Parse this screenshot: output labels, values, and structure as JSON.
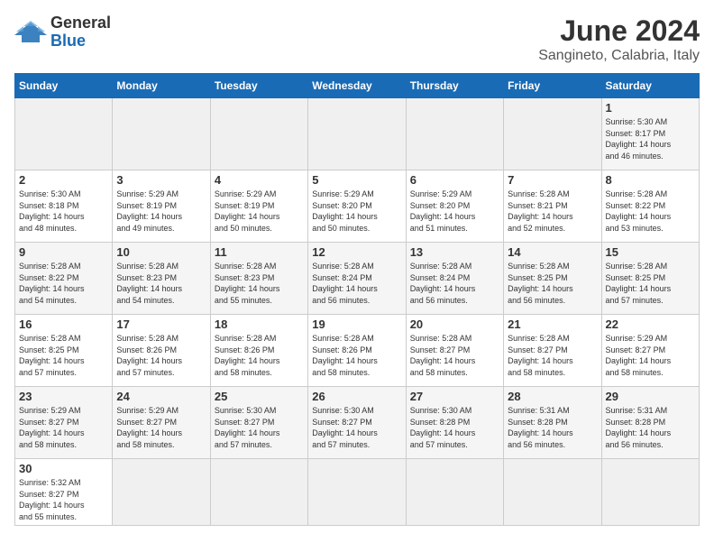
{
  "header": {
    "logo_general": "General",
    "logo_blue": "Blue",
    "title": "June 2024",
    "subtitle": "Sangineto, Calabria, Italy"
  },
  "weekdays": [
    "Sunday",
    "Monday",
    "Tuesday",
    "Wednesday",
    "Thursday",
    "Friday",
    "Saturday"
  ],
  "weeks": [
    [
      {
        "day": "",
        "info": ""
      },
      {
        "day": "",
        "info": ""
      },
      {
        "day": "",
        "info": ""
      },
      {
        "day": "",
        "info": ""
      },
      {
        "day": "",
        "info": ""
      },
      {
        "day": "",
        "info": ""
      },
      {
        "day": "1",
        "info": "Sunrise: 5:30 AM\nSunset: 8:17 PM\nDaylight: 14 hours\nand 46 minutes."
      }
    ],
    [
      {
        "day": "2",
        "info": "Sunrise: 5:30 AM\nSunset: 8:18 PM\nDaylight: 14 hours\nand 48 minutes."
      },
      {
        "day": "3",
        "info": "Sunrise: 5:29 AM\nSunset: 8:19 PM\nDaylight: 14 hours\nand 49 minutes."
      },
      {
        "day": "4",
        "info": "Sunrise: 5:29 AM\nSunset: 8:19 PM\nDaylight: 14 hours\nand 50 minutes."
      },
      {
        "day": "5",
        "info": "Sunrise: 5:29 AM\nSunset: 8:20 PM\nDaylight: 14 hours\nand 50 minutes."
      },
      {
        "day": "6",
        "info": "Sunrise: 5:29 AM\nSunset: 8:20 PM\nDaylight: 14 hours\nand 51 minutes."
      },
      {
        "day": "7",
        "info": "Sunrise: 5:28 AM\nSunset: 8:21 PM\nDaylight: 14 hours\nand 52 minutes."
      },
      {
        "day": "8",
        "info": "Sunrise: 5:28 AM\nSunset: 8:22 PM\nDaylight: 14 hours\nand 53 minutes."
      }
    ],
    [
      {
        "day": "9",
        "info": "Sunrise: 5:28 AM\nSunset: 8:22 PM\nDaylight: 14 hours\nand 54 minutes."
      },
      {
        "day": "10",
        "info": "Sunrise: 5:28 AM\nSunset: 8:23 PM\nDaylight: 14 hours\nand 54 minutes."
      },
      {
        "day": "11",
        "info": "Sunrise: 5:28 AM\nSunset: 8:23 PM\nDaylight: 14 hours\nand 55 minutes."
      },
      {
        "day": "12",
        "info": "Sunrise: 5:28 AM\nSunset: 8:24 PM\nDaylight: 14 hours\nand 56 minutes."
      },
      {
        "day": "13",
        "info": "Sunrise: 5:28 AM\nSunset: 8:24 PM\nDaylight: 14 hours\nand 56 minutes."
      },
      {
        "day": "14",
        "info": "Sunrise: 5:28 AM\nSunset: 8:25 PM\nDaylight: 14 hours\nand 56 minutes."
      },
      {
        "day": "15",
        "info": "Sunrise: 5:28 AM\nSunset: 8:25 PM\nDaylight: 14 hours\nand 57 minutes."
      }
    ],
    [
      {
        "day": "16",
        "info": "Sunrise: 5:28 AM\nSunset: 8:25 PM\nDaylight: 14 hours\nand 57 minutes."
      },
      {
        "day": "17",
        "info": "Sunrise: 5:28 AM\nSunset: 8:26 PM\nDaylight: 14 hours\nand 57 minutes."
      },
      {
        "day": "18",
        "info": "Sunrise: 5:28 AM\nSunset: 8:26 PM\nDaylight: 14 hours\nand 58 minutes."
      },
      {
        "day": "19",
        "info": "Sunrise: 5:28 AM\nSunset: 8:26 PM\nDaylight: 14 hours\nand 58 minutes."
      },
      {
        "day": "20",
        "info": "Sunrise: 5:28 AM\nSunset: 8:27 PM\nDaylight: 14 hours\nand 58 minutes."
      },
      {
        "day": "21",
        "info": "Sunrise: 5:28 AM\nSunset: 8:27 PM\nDaylight: 14 hours\nand 58 minutes."
      },
      {
        "day": "22",
        "info": "Sunrise: 5:29 AM\nSunset: 8:27 PM\nDaylight: 14 hours\nand 58 minutes."
      }
    ],
    [
      {
        "day": "23",
        "info": "Sunrise: 5:29 AM\nSunset: 8:27 PM\nDaylight: 14 hours\nand 58 minutes."
      },
      {
        "day": "24",
        "info": "Sunrise: 5:29 AM\nSunset: 8:27 PM\nDaylight: 14 hours\nand 58 minutes."
      },
      {
        "day": "25",
        "info": "Sunrise: 5:30 AM\nSunset: 8:27 PM\nDaylight: 14 hours\nand 57 minutes."
      },
      {
        "day": "26",
        "info": "Sunrise: 5:30 AM\nSunset: 8:27 PM\nDaylight: 14 hours\nand 57 minutes."
      },
      {
        "day": "27",
        "info": "Sunrise: 5:30 AM\nSunset: 8:28 PM\nDaylight: 14 hours\nand 57 minutes."
      },
      {
        "day": "28",
        "info": "Sunrise: 5:31 AM\nSunset: 8:28 PM\nDaylight: 14 hours\nand 56 minutes."
      },
      {
        "day": "29",
        "info": "Sunrise: 5:31 AM\nSunset: 8:28 PM\nDaylight: 14 hours\nand 56 minutes."
      }
    ],
    [
      {
        "day": "30",
        "info": "Sunrise: 5:32 AM\nSunset: 8:27 PM\nDaylight: 14 hours\nand 55 minutes."
      },
      {
        "day": "",
        "info": ""
      },
      {
        "day": "",
        "info": ""
      },
      {
        "day": "",
        "info": ""
      },
      {
        "day": "",
        "info": ""
      },
      {
        "day": "",
        "info": ""
      },
      {
        "day": "",
        "info": ""
      }
    ]
  ]
}
